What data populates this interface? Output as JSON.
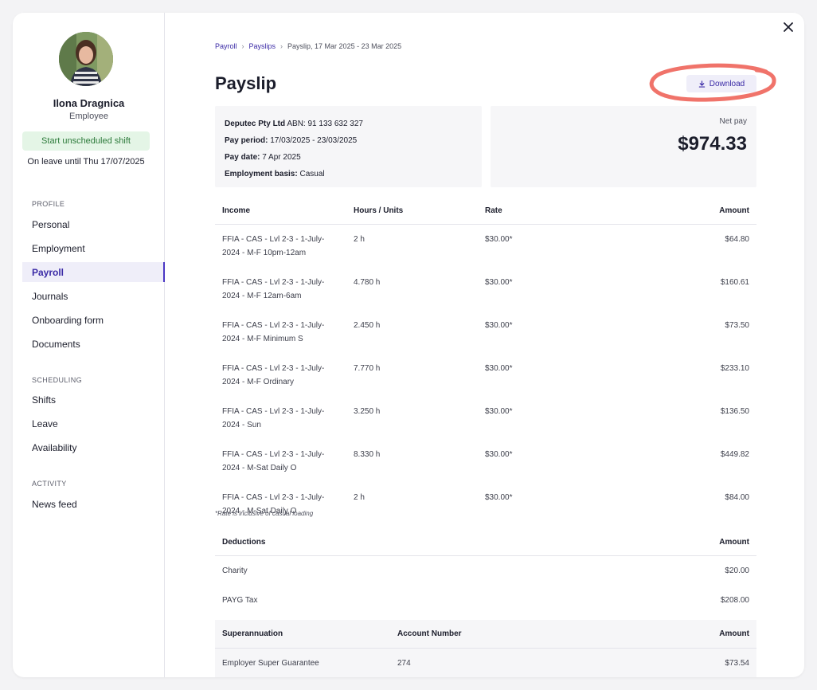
{
  "employee": {
    "name": "Ilona Dragnica",
    "role": "Employee",
    "shift_button": "Start unscheduled shift",
    "leave_note": "On leave until Thu 17/07/2025"
  },
  "sidebar": {
    "profile_label": "PROFILE",
    "profile_items": [
      "Personal",
      "Employment",
      "Payroll",
      "Journals",
      "Onboarding form",
      "Documents"
    ],
    "active_item": "Payroll",
    "scheduling_label": "SCHEDULING",
    "scheduling_items": [
      "Shifts",
      "Leave",
      "Availability"
    ],
    "activity_label": "ACTIVITY",
    "activity_items": [
      "News feed"
    ]
  },
  "breadcrumb": {
    "items": [
      "Payroll",
      "Payslips",
      "Payslip, 17 Mar 2025 - 23 Mar 2025"
    ]
  },
  "page": {
    "title": "Payslip",
    "download_label": "Download"
  },
  "info": {
    "company": "Deputec Pty Ltd",
    "abn_label": "ABN:",
    "abn": "91 133 632 327",
    "pay_period_label": "Pay period:",
    "pay_period": "17/03/2025 - 23/03/2025",
    "pay_date_label": "Pay date:",
    "pay_date": "7 Apr 2025",
    "basis_label": "Employment basis:",
    "basis": "Casual"
  },
  "net_pay": {
    "label": "Net pay",
    "value": "$974.33"
  },
  "income": {
    "headers": [
      "Income",
      "Hours / Units",
      "Rate",
      "Amount"
    ],
    "rows": [
      {
        "desc": "FFIA - CAS - Lvl 2-3 - 1-July-2024 - M-F 10pm-12am",
        "hours": "2 h",
        "rate": "$30.00*",
        "amount": "$64.80"
      },
      {
        "desc": "FFIA - CAS - Lvl 2-3 - 1-July-2024 - M-F 12am-6am",
        "hours": "4.780 h",
        "rate": "$30.00*",
        "amount": "$160.61"
      },
      {
        "desc": "FFIA - CAS - Lvl 2-3 - 1-July-2024 - M-F Minimum S",
        "hours": "2.450 h",
        "rate": "$30.00*",
        "amount": "$73.50"
      },
      {
        "desc": "FFIA - CAS - Lvl 2-3 - 1-July-2024 - M-F Ordinary",
        "hours": "7.770 h",
        "rate": "$30.00*",
        "amount": "$233.10"
      },
      {
        "desc": "FFIA - CAS - Lvl 2-3 - 1-July-2024 - Sun",
        "hours": "3.250 h",
        "rate": "$30.00*",
        "amount": "$136.50"
      },
      {
        "desc": "FFIA - CAS - Lvl 2-3 - 1-July-2024 - M-Sat Daily O",
        "hours": "8.330 h",
        "rate": "$30.00*",
        "amount": "$449.82"
      },
      {
        "desc": "FFIA - CAS - Lvl 2-3 - 1-July-2024 - M-Sat Daily O",
        "hours": "2 h",
        "rate": "$30.00*",
        "amount": "$84.00"
      }
    ],
    "footnote": "*Rate is inclusive of casual loading"
  },
  "deductions": {
    "headers": [
      "Deductions",
      "Amount"
    ],
    "rows": [
      {
        "desc": "Charity",
        "amount": "$20.00"
      },
      {
        "desc": "PAYG Tax",
        "amount": "$208.00"
      }
    ]
  },
  "superannuation": {
    "headers": [
      "Superannuation",
      "Account Number",
      "Amount"
    ],
    "rows": [
      {
        "desc": "Employer Super Guarantee",
        "account": "274",
        "amount": "$73.54"
      }
    ]
  },
  "colors": {
    "accent": "#3a2aa6",
    "annotation": "#f0736a",
    "shift_bg": "#e4f5e6",
    "shift_text": "#2c7a3a"
  },
  "icons": {
    "close": "close-icon",
    "download": "download-icon",
    "breadcrumb_sep": "chevron-right-icon"
  }
}
